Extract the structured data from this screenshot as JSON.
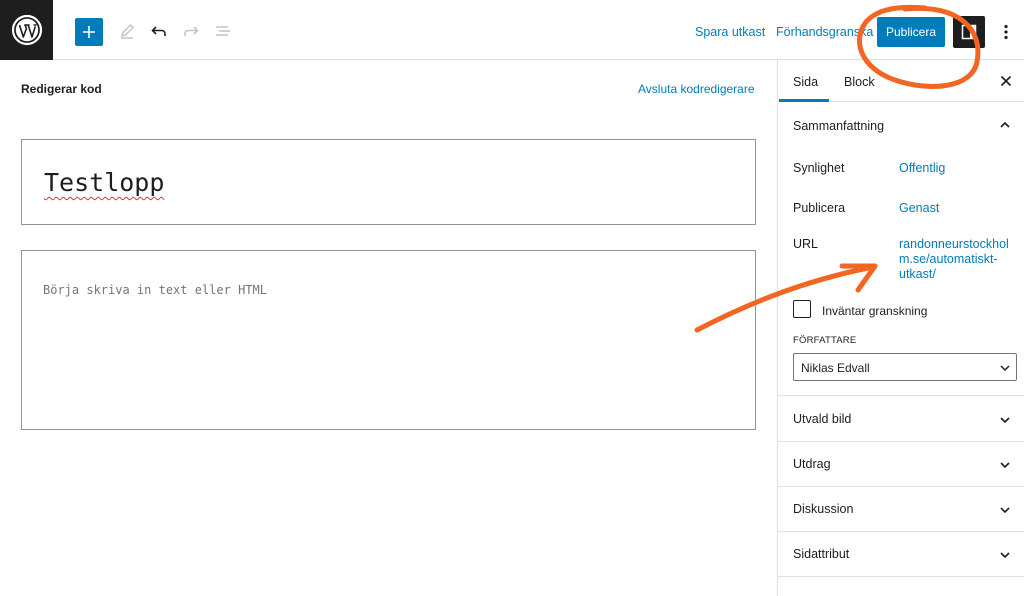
{
  "toolbar": {
    "logo_icon": "wordpress-logo",
    "add_icon": "plus-icon",
    "tools_icon": "pencil-icon",
    "undo_icon": "undo-icon",
    "redo_icon": "redo-icon",
    "list_view_icon": "list-view-icon",
    "save_draft_label": "Spara utkast",
    "preview_label": "Förhandsgranska",
    "publish_label": "Publicera",
    "settings_icon": "settings-panel-icon",
    "more_icon": "more-vertical-icon",
    "accent_color": "#007cba"
  },
  "editor": {
    "mode_label": "Redigerar kod",
    "exit_code_label": "Avsluta kodredigerare",
    "title_value": "Testlopp",
    "body_placeholder": "Börja skriva in text eller HTML"
  },
  "sidebar": {
    "tabs": [
      {
        "label": "Sida",
        "active": true
      },
      {
        "label": "Block",
        "active": false
      }
    ],
    "close_icon": "close-icon",
    "summary": {
      "title": "Sammanfattning",
      "expanded": true,
      "rows": [
        {
          "label": "Synlighet",
          "value": "Offentlig"
        },
        {
          "label": "Publicera",
          "value": "Genast"
        },
        {
          "label": "URL",
          "value_lines": [
            "randonneurstockhol",
            "m.se/automatiskt-",
            "utkast/"
          ]
        }
      ],
      "pending_review_label": "Inväntar granskning",
      "pending_review_checked": false,
      "author_label": "FÖRFATTARE",
      "author_value": "Niklas Edvall"
    },
    "panels": [
      {
        "label": "Utvald bild"
      },
      {
        "label": "Utdrag"
      },
      {
        "label": "Diskussion"
      },
      {
        "label": "Sidattribut"
      }
    ]
  },
  "annotation": {
    "color": "#f26522"
  }
}
